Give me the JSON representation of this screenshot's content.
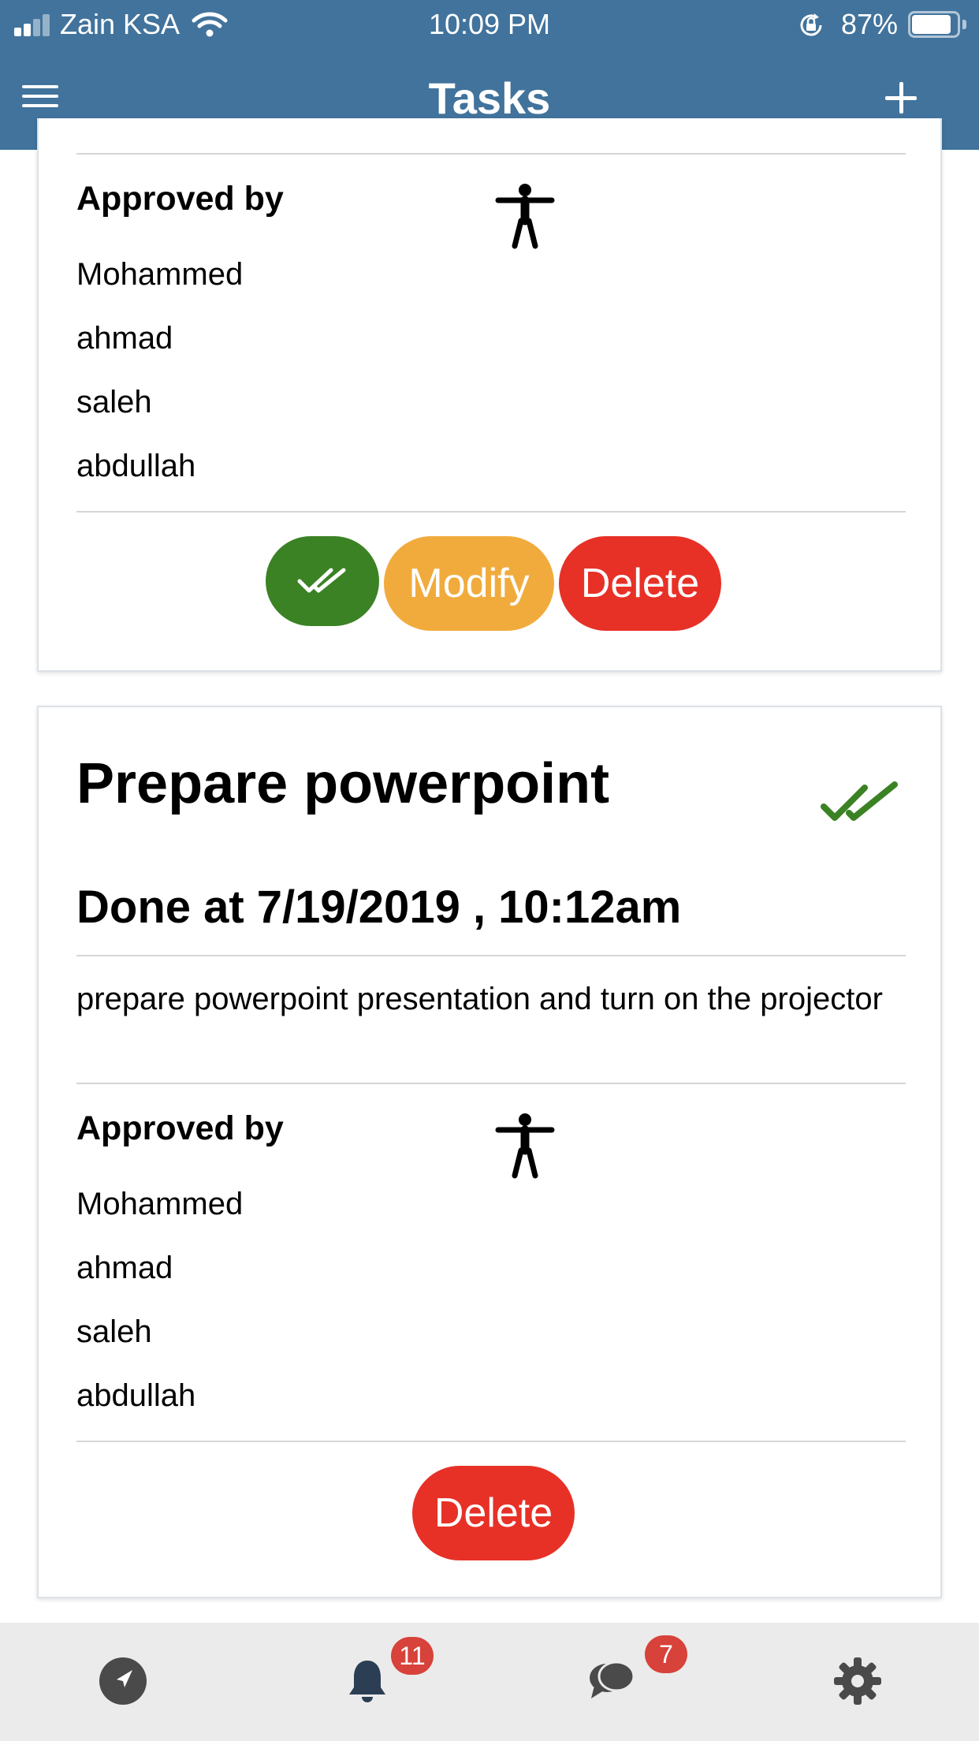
{
  "status_bar": {
    "carrier": "Zain KSA",
    "time": "10:09 PM",
    "battery_percent": "87%",
    "battery_level": 0.87
  },
  "nav": {
    "title": "Tasks",
    "menu_icon": "hamburger-menu-icon",
    "add_icon": "plus-icon"
  },
  "tasks": [
    {
      "approved_label": "Approved by",
      "approvers": [
        "Mohammed",
        "ahmad",
        "saleh",
        "abdullah"
      ],
      "actions": {
        "approve_icon": "double-check-icon",
        "modify": "Modify",
        "delete": "Delete"
      }
    },
    {
      "title": "Prepare powerpoint",
      "done_at": "Done at 7/19/2019 , 10:12am",
      "description": "prepare powerpoint presentation and turn on the projector",
      "approved_label": "Approved by",
      "approvers": [
        "Mohammed",
        "ahmad",
        "saleh",
        "abdullah"
      ],
      "actions": {
        "delete": "Delete"
      }
    }
  ],
  "tabbar": {
    "items": [
      {
        "icon": "location-arrow-icon"
      },
      {
        "icon": "bell-icon",
        "badge": "11"
      },
      {
        "icon": "chat-bubbles-icon",
        "badge": "7"
      },
      {
        "icon": "gear-icon"
      }
    ]
  },
  "colors": {
    "header": "#41739c",
    "approve": "#3b8224",
    "modify": "#f1ab3d",
    "delete": "#e73127",
    "badge": "#d7423a",
    "tabbar": "#ebebeb"
  }
}
